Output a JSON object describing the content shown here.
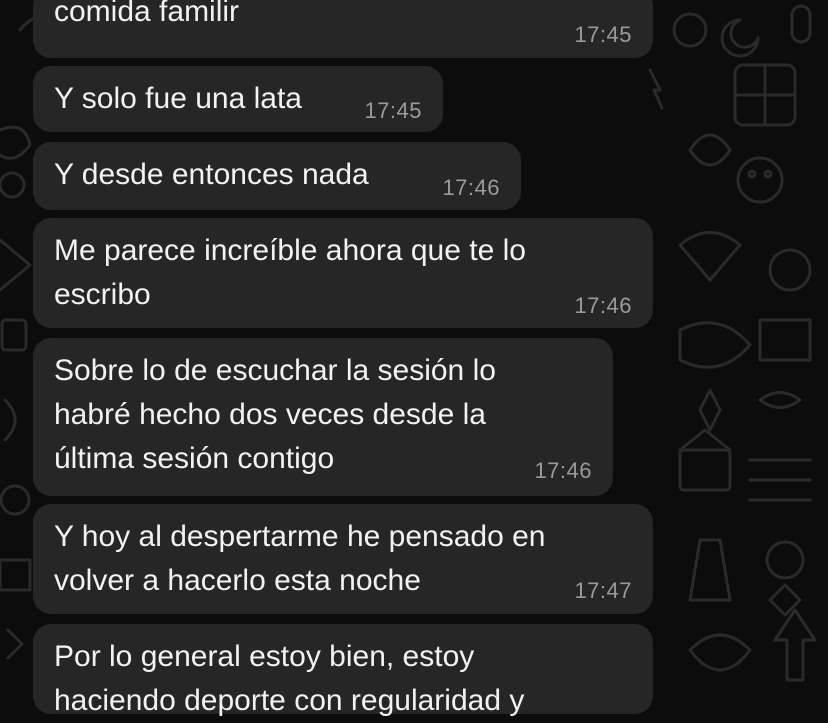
{
  "chat": {
    "messages": [
      {
        "text": "comida familir",
        "time": "17:45"
      },
      {
        "text": "Y solo fue una lata",
        "time": "17:45"
      },
      {
        "text": "Y desde entonces nada",
        "time": "17:46"
      },
      {
        "text": "Me parece increíble ahora que te lo\nescribo",
        "time": "17:46"
      },
      {
        "text": "Sobre lo de escuchar la sesión lo\nhabré hecho dos veces desde la\núltima sesión contigo",
        "time": "17:46"
      },
      {
        "text": "Y hoy al despertarme he pensado en\nvolver a hacerlo esta noche",
        "time": "17:47"
      },
      {
        "text": "Por lo general estoy bien, estoy\nhaciendo deporte con regularidad y",
        "time": ""
      }
    ]
  }
}
